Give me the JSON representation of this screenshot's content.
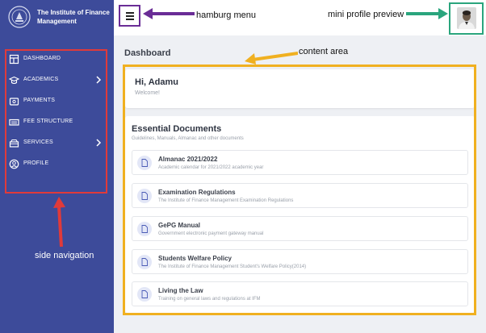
{
  "brand": {
    "name": "The Institute of Finance Management"
  },
  "sidebar": {
    "items": [
      {
        "label": "DASHBOARD",
        "icon": "dashboard-icon",
        "has_submenu": false
      },
      {
        "label": "ACADEMICS",
        "icon": "graduation-cap-icon",
        "has_submenu": true
      },
      {
        "label": "PAYMENTS",
        "icon": "wallet-icon",
        "has_submenu": false
      },
      {
        "label": "FEE STRUCTURE",
        "icon": "money-icon",
        "has_submenu": false
      },
      {
        "label": "SERVICES",
        "icon": "box-icon",
        "has_submenu": true
      },
      {
        "label": "PROFILE",
        "icon": "user-circle-icon",
        "has_submenu": false
      }
    ]
  },
  "page": {
    "title": "Dashboard"
  },
  "greeting": {
    "name": "Hi, Adamu",
    "message": "Welcome!"
  },
  "documents": {
    "title": "Essential Documents",
    "subtitle": "Guidelines, Manuals, Almanac and other documents",
    "items": [
      {
        "title": "Almanac 2021/2022",
        "description": "Academic calendar for 2021/2022 academic year"
      },
      {
        "title": "Examination Regulations",
        "description": "The Institute of Finance Management Examination Regulations"
      },
      {
        "title": "GePG Manual",
        "description": "Government electronic payment gateway manual"
      },
      {
        "title": "Students Welfare Policy",
        "description": "The Institute of Finance Management Student's Welfare Policy(2014)"
      },
      {
        "title": "Living the Law",
        "description": "Training on general laws and regulations at IFM"
      }
    ]
  },
  "annotations": {
    "hamburg": "hamburg menu",
    "profile": "mini profile preview",
    "content": "content area",
    "sidenav": "side navigation"
  },
  "colors": {
    "sidebar": "#3d4b9a",
    "sidenav_annotation": "#e03a3a",
    "content_annotation": "#f0b020",
    "hamburg_annotation": "#6a2d96",
    "profile_annotation": "#2aa57d"
  }
}
